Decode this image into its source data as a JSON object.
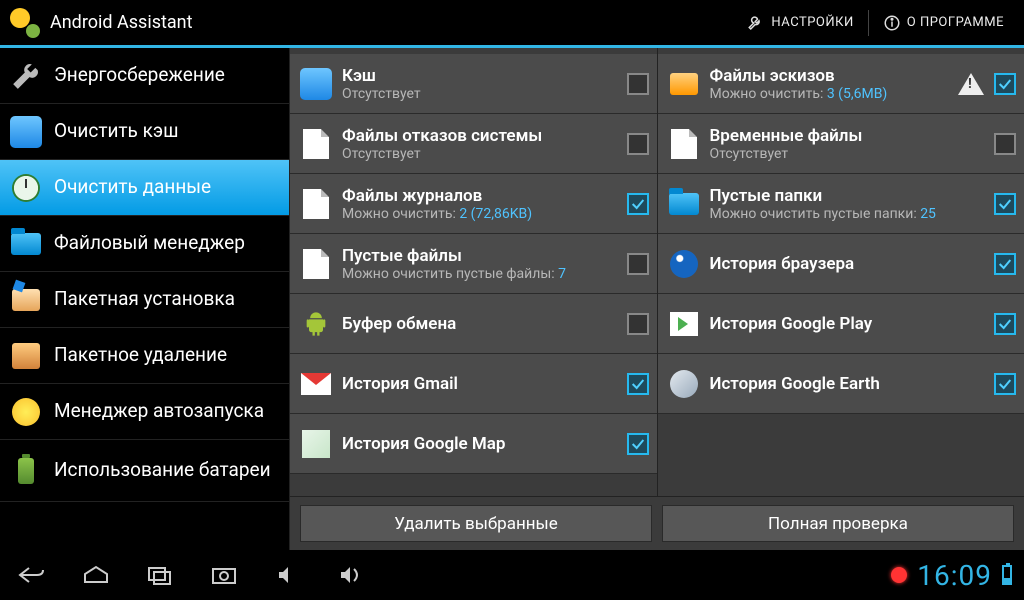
{
  "header": {
    "app_title": "Android Assistant",
    "settings_label": "НАСТРОЙКИ",
    "about_label": "О ПРОГРАММЕ"
  },
  "sidebar": {
    "items": [
      {
        "label": "Энергосбережение",
        "icon": "wrench-icon"
      },
      {
        "label": "Очистить кэш",
        "icon": "cube-blue-icon"
      },
      {
        "label": "Очистить данные",
        "icon": "clock-icon",
        "selected": true
      },
      {
        "label": "Файловый менеджер",
        "icon": "folder-icon"
      },
      {
        "label": "Пакетная установка",
        "icon": "box-open-icon"
      },
      {
        "label": "Пакетное удаление",
        "icon": "package-icon"
      },
      {
        "label": "Менеджер автозапуска",
        "icon": "smile-icon"
      },
      {
        "label": "Использование батареи",
        "icon": "battery-icon"
      }
    ]
  },
  "columns": {
    "left": [
      {
        "title": "Кэш",
        "sub_plain": "Отсутствует",
        "checked": false,
        "icon": "cube-blue"
      },
      {
        "title": "Файлы отказов системы",
        "sub_plain": "Отсутствует",
        "checked": false,
        "icon": "file"
      },
      {
        "title": "Файлы журналов",
        "sub_prefix": "Можно очистить: ",
        "sub_value": "2 (72,86KB)",
        "checked": true,
        "icon": "file"
      },
      {
        "title": "Пустые файлы",
        "sub_prefix": "Можно очистить пустые файлы: ",
        "sub_value": "7",
        "checked": false,
        "icon": "file-blank"
      },
      {
        "title": "Буфер обмена",
        "checked": false,
        "icon": "android"
      },
      {
        "title": "История Gmail",
        "checked": true,
        "icon": "gmail"
      },
      {
        "title": "История Google Map",
        "checked": true,
        "icon": "map"
      }
    ],
    "right": [
      {
        "title": "Файлы эскизов",
        "sub_prefix": "Можно очистить: ",
        "sub_value": "3 (5,6MB)",
        "checked": true,
        "icon": "thumb",
        "warn": true
      },
      {
        "title": "Временные файлы",
        "sub_plain": "Отсутствует",
        "checked": false,
        "icon": "file"
      },
      {
        "title": "Пустые папки",
        "sub_prefix": "Можно очистить пустые папки: ",
        "sub_value": "25",
        "checked": true,
        "icon": "folder"
      },
      {
        "title": "История браузера",
        "checked": true,
        "icon": "globe"
      },
      {
        "title": "История Google Play",
        "checked": true,
        "icon": "play"
      },
      {
        "title": "История Google Earth",
        "checked": true,
        "icon": "earth"
      }
    ]
  },
  "buttons": {
    "delete_selected": "Удалить выбранные",
    "full_scan": "Полная проверка"
  },
  "navbar": {
    "time": "16:09"
  }
}
